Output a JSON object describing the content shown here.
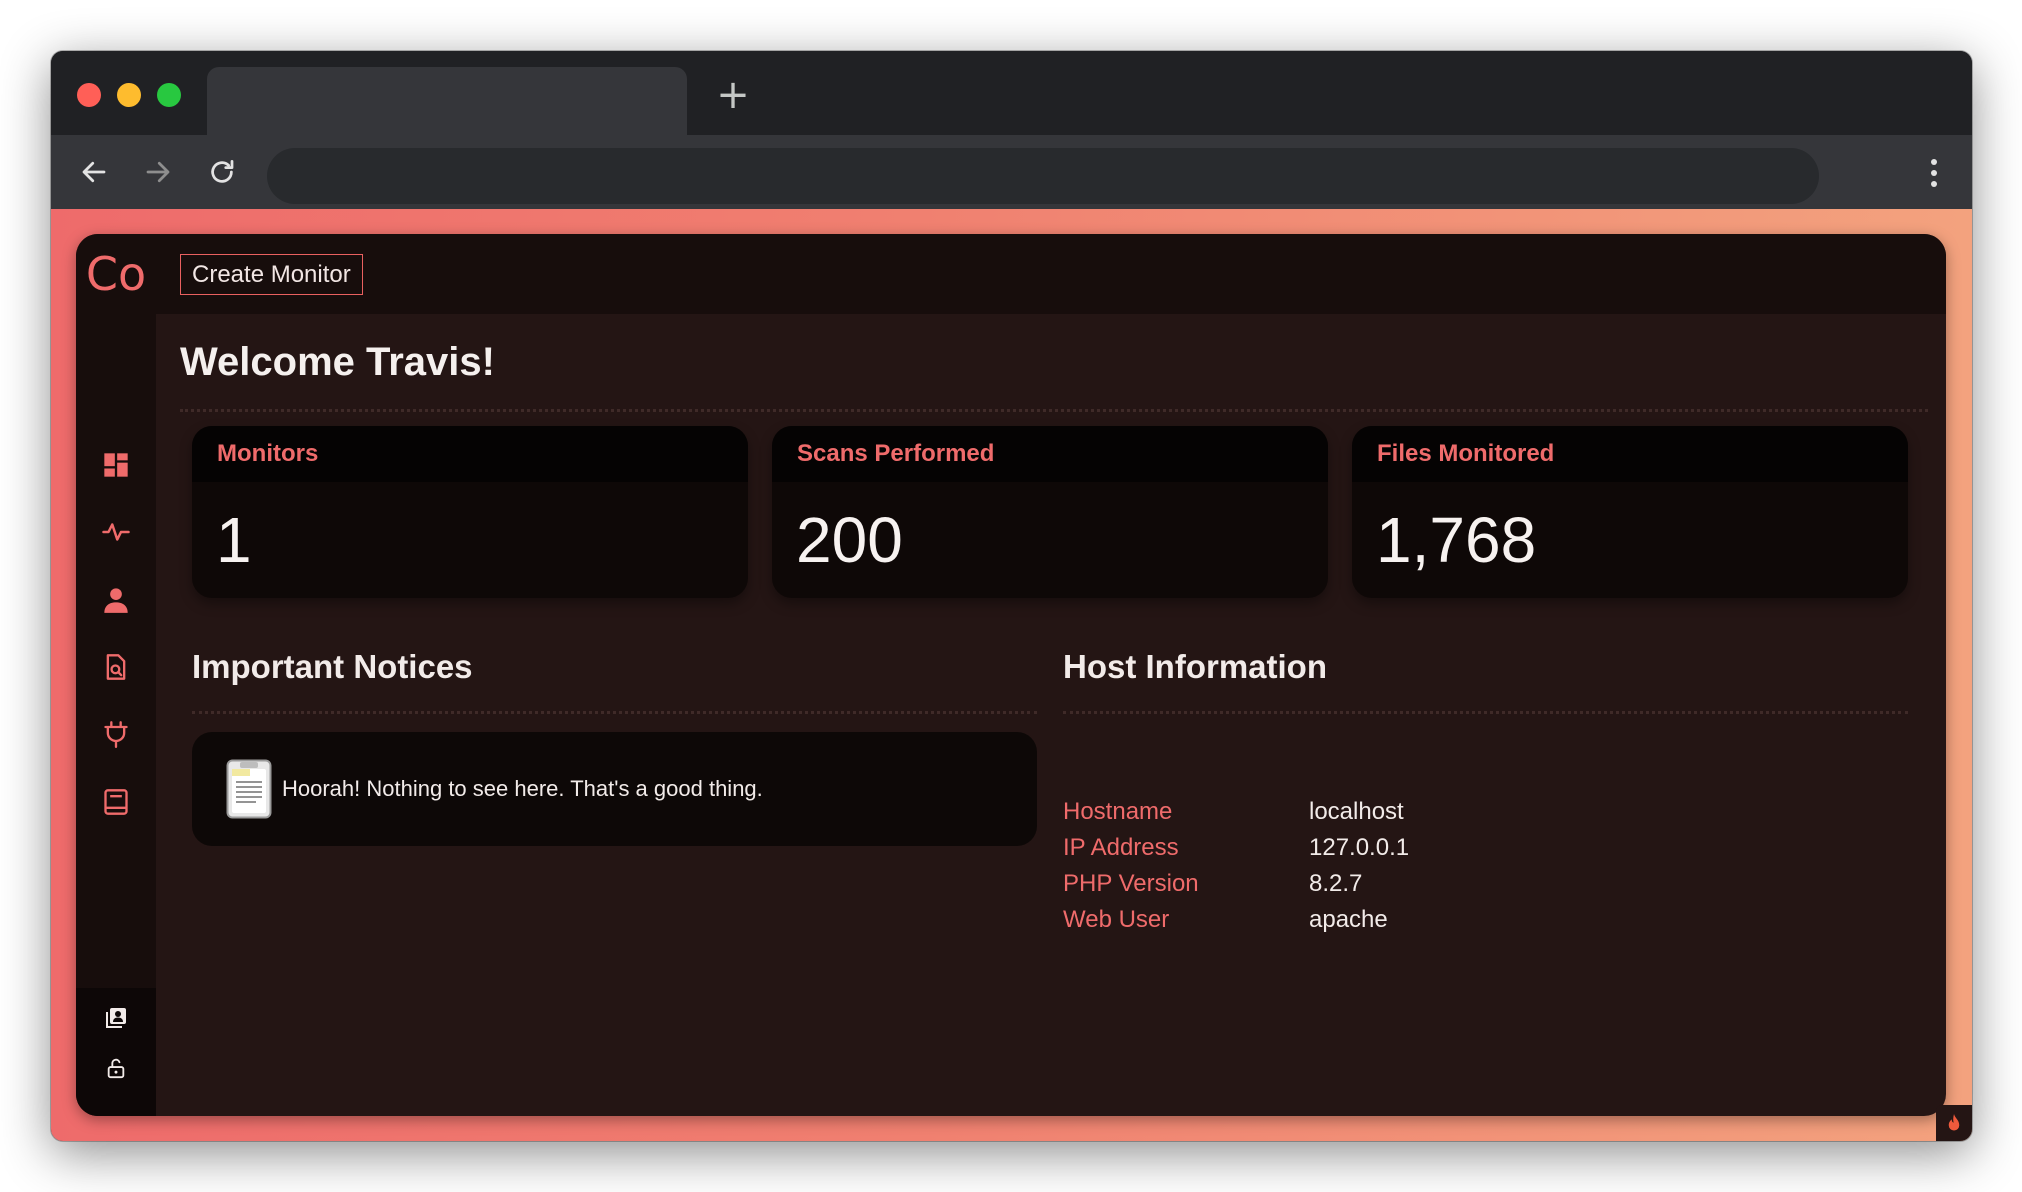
{
  "browser": {
    "new_tab_label": "+",
    "colors": {
      "frame": "#202124",
      "toolbar": "#35363a",
      "omnibox": "#282a2d"
    }
  },
  "app": {
    "logo": "Co",
    "create_button": "Create Monitor",
    "welcome": "Welcome Travis!",
    "sidebar_icons": [
      "dashboard-icon",
      "activity-pulse-icon",
      "user-icon",
      "file-search-icon",
      "plug-icon",
      "book-icon"
    ],
    "sidebar_bottom_icons": [
      "contacts-icon",
      "unlock-icon"
    ],
    "stats": [
      {
        "label": "Monitors",
        "value": "1"
      },
      {
        "label": "Scans Performed",
        "value": "200"
      },
      {
        "label": "Files Monitored",
        "value": "1,768"
      }
    ],
    "notices": {
      "title": "Important Notices",
      "message": "Hoorah! Nothing to see here. That's a good thing."
    },
    "host": {
      "title": "Host Information",
      "rows": [
        {
          "key": "Hostname",
          "value": "localhost"
        },
        {
          "key": "IP Address",
          "value": "127.0.0.1"
        },
        {
          "key": "PHP Version",
          "value": "8.2.7"
        },
        {
          "key": "Web User",
          "value": "apache"
        }
      ]
    },
    "colors": {
      "accent": "#ef6b6b",
      "background": "#241514",
      "card": "#0e0807",
      "gradient_start": "#ee6b6b",
      "gradient_end": "#f3a27e"
    }
  }
}
